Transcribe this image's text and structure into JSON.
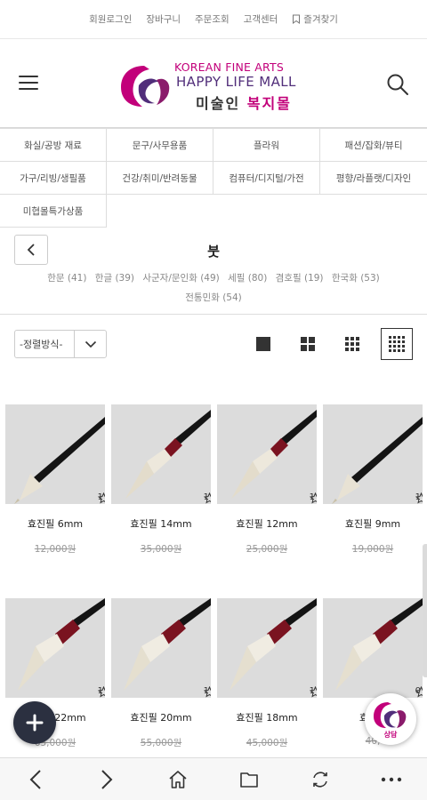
{
  "top_links": [
    "회원로그인",
    "장바구니",
    "주문조회",
    "고객센터",
    "즐겨찾기"
  ],
  "logo": {
    "line1": "KOREAN FINE ARTS",
    "line2": "HAPPY LIFE MALL",
    "line3a": "미술인 ",
    "line3b": "복지몰"
  },
  "categories": [
    "화실/공방 재료",
    "문구/사무용품",
    "플라워",
    "패션/잡화/뷰티",
    "가구/리빙/생필품",
    "건강/취미/반려동물",
    "컴퓨터/디지털/가전",
    "평향/라플랫/디자인",
    "미협몰특가상품"
  ],
  "category_page": {
    "title": "붓",
    "subcategories": [
      "한문 (41)",
      "한글 (39)",
      "사군자/문인화 (49)",
      "세필 (80)",
      "겸호필 (19)",
      "한국화 (53)",
      "전통민화 (54)"
    ]
  },
  "sort": {
    "label": "-정렬방식-"
  },
  "products": [
    {
      "name": "효진필 6mm",
      "price": "12,000원",
      "wish": "1",
      "style": "black"
    },
    {
      "name": "효진필 14mm",
      "price": "35,000원",
      "wish": "1",
      "style": "red"
    },
    {
      "name": "효진필 12mm",
      "price": "25,000원",
      "wish": "1",
      "style": "red"
    },
    {
      "name": "효진필 9mm",
      "price": "19,000원",
      "wish": "1",
      "style": "black"
    },
    {
      "name": "효진필 22mm",
      "price": "65,000원",
      "wish": "1",
      "style": "redthick",
      "name_visible": "22mm",
      "price_visible": "5,000원"
    },
    {
      "name": "효진필 20mm",
      "price": "55,000원",
      "wish": "1",
      "style": "redthick"
    },
    {
      "name": "효진필 18mm",
      "price": "45,000원",
      "wish": "1",
      "style": "redthick"
    },
    {
      "name": "효진필",
      "price": "40,",
      "wish": "0",
      "style": "redthick"
    }
  ],
  "chat": {
    "label": "상담"
  },
  "colors": {
    "brand_pink": "#c2007a",
    "brand_purple": "#512e7a",
    "fab": "#2b3040"
  }
}
